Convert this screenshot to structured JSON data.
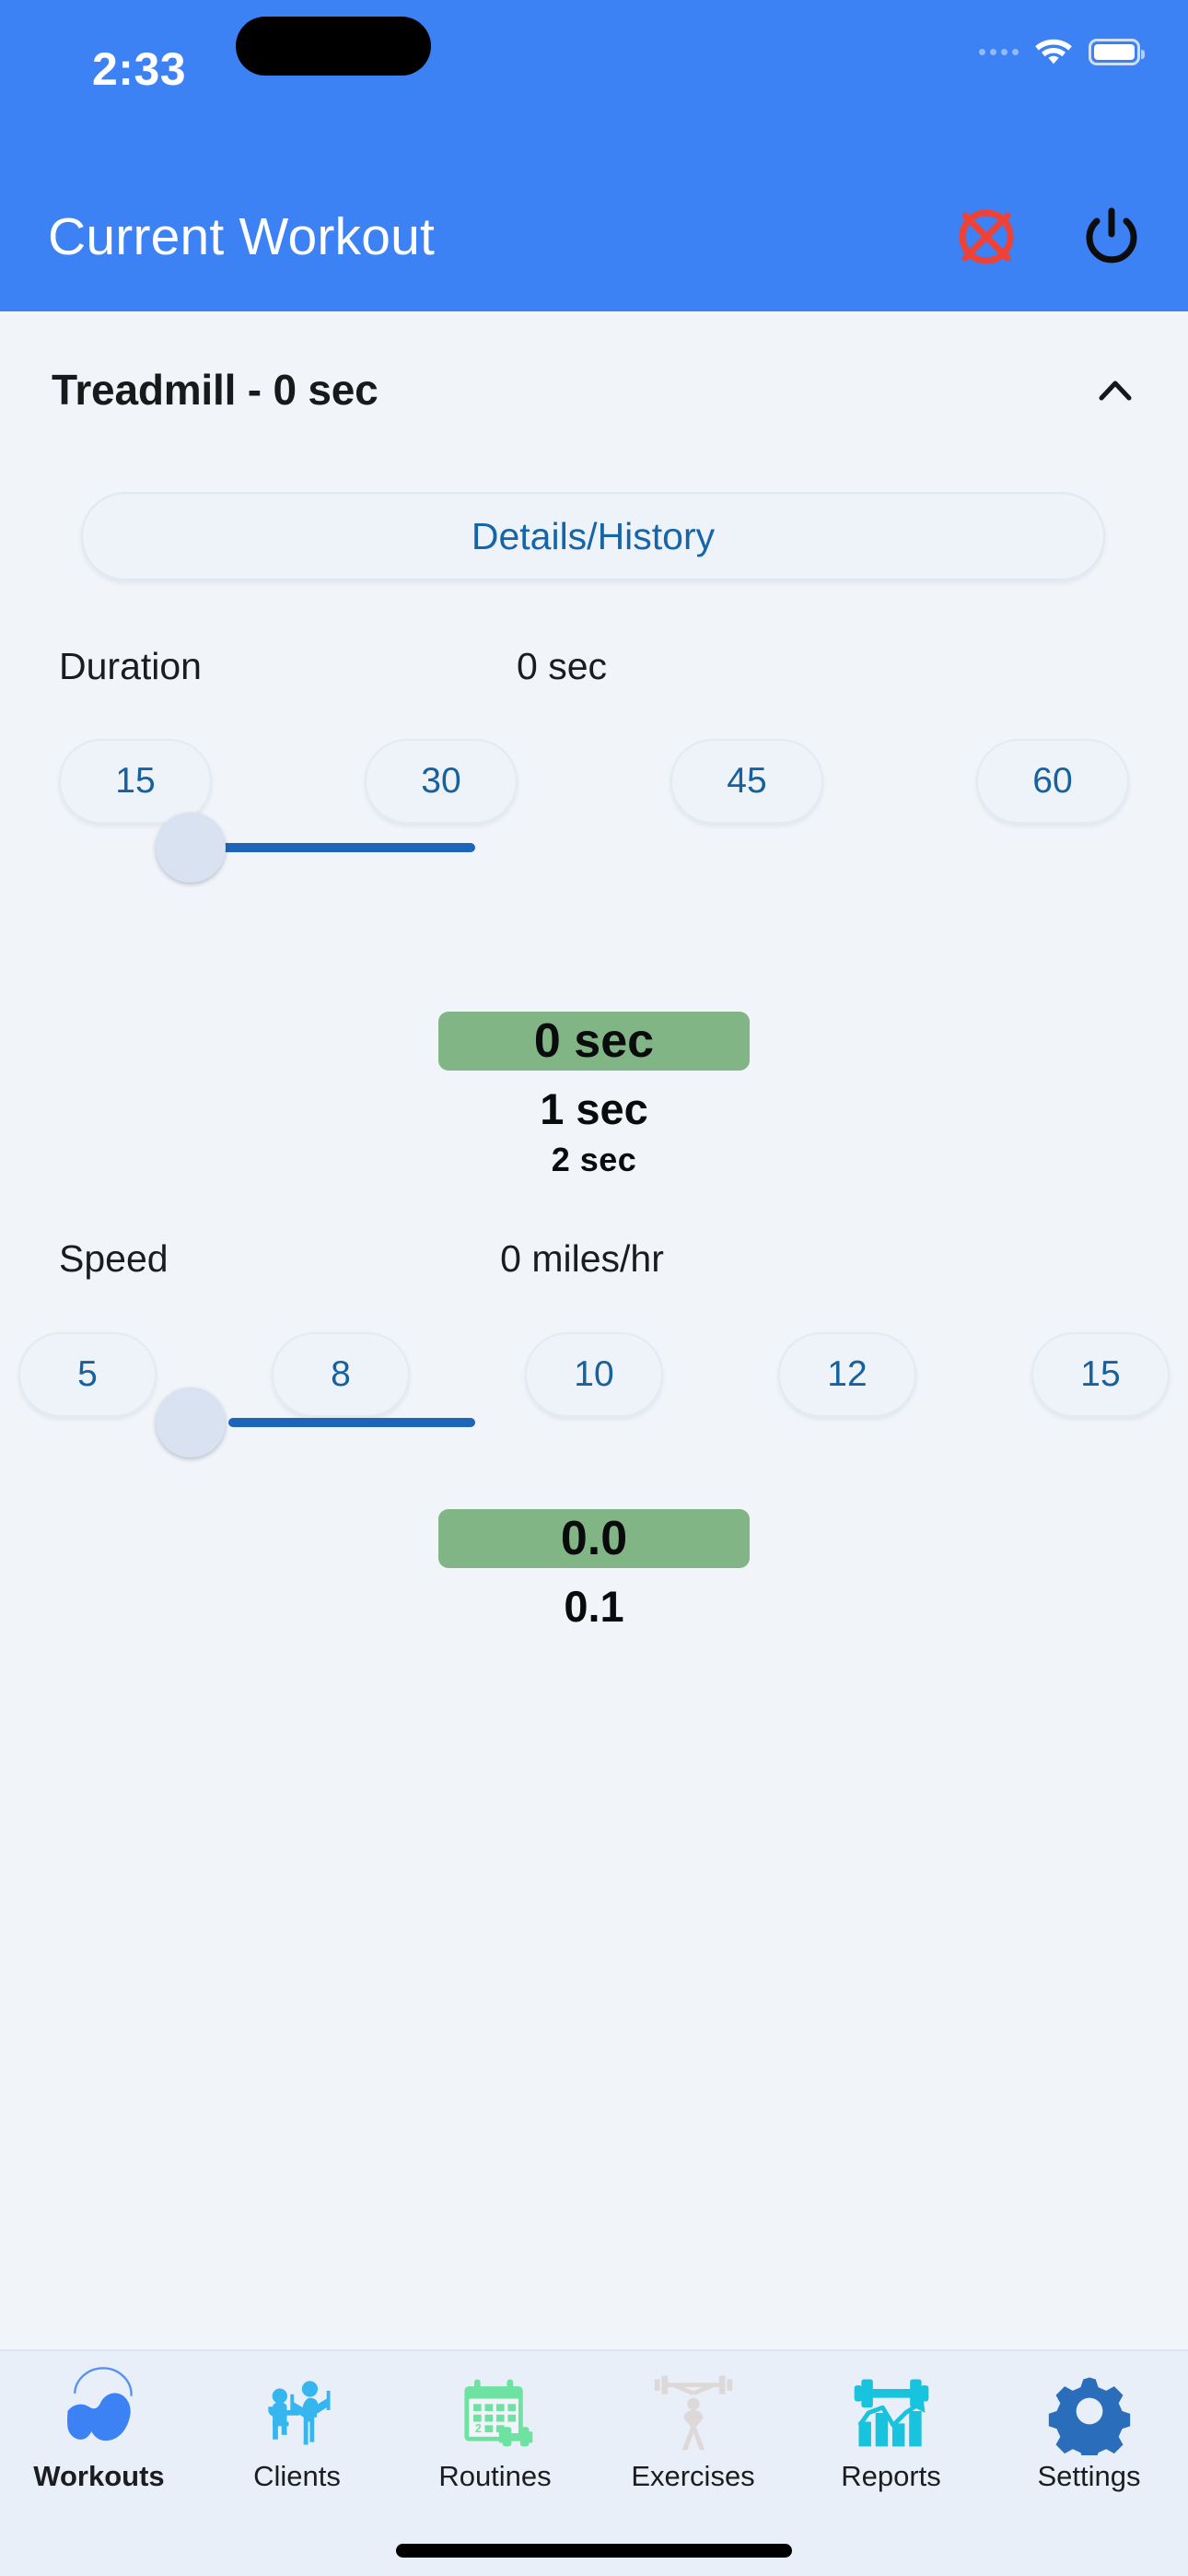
{
  "status_bar": {
    "time": "2:33",
    "icons": [
      "cellular-signal-icon",
      "wifi-icon",
      "battery-icon"
    ]
  },
  "app_bar": {
    "title": "Current Workout",
    "cancel_icon": "cancel-circle-x-icon",
    "power_icon": "power-icon"
  },
  "exercise": {
    "heading": "Treadmill - 0 sec",
    "collapse_icon": "chevron-up-icon",
    "details_button": "Details/History"
  },
  "duration": {
    "label": "Duration",
    "value": "0 sec",
    "presets": [
      "15",
      "30",
      "45",
      "60"
    ],
    "slider": {
      "value": 0,
      "min": 0,
      "max": 60
    },
    "picker": {
      "selected": "0 sec",
      "next": "1 sec",
      "next2": "2 sec"
    }
  },
  "speed": {
    "label": "Speed",
    "value": "0 miles/hr",
    "presets": [
      "5",
      "8",
      "10",
      "12",
      "15"
    ],
    "slider": {
      "value": 0,
      "min": 0,
      "max": 15
    },
    "picker": {
      "selected": "0.0",
      "next": "0.1"
    }
  },
  "tab_bar": {
    "active": "Workouts",
    "items": [
      {
        "label": "Workouts",
        "icon": "bicep-flex-icon",
        "color": "#3d82f5"
      },
      {
        "label": "Clients",
        "icon": "trainer-clients-icon",
        "color": "#35b6ef"
      },
      {
        "label": "Routines",
        "icon": "calendar-dumbbell-icon",
        "color": "#6ee2a0"
      },
      {
        "label": "Exercises",
        "icon": "weightlifter-icon",
        "color": "#ddd9d8"
      },
      {
        "label": "Reports",
        "icon": "chart-dumbbell-icon",
        "color": "#17c3dd"
      },
      {
        "label": "Settings",
        "icon": "gear-icon",
        "color": "#2a6ebb"
      }
    ]
  },
  "theme": {
    "header_blue": "#3d82f5",
    "page_bg": "#f1f4f9",
    "accent_blue": "#1565a8",
    "slider_blue": "#1d65b8",
    "picker_green": "#82b586",
    "cancel_red": "#ef4136"
  }
}
